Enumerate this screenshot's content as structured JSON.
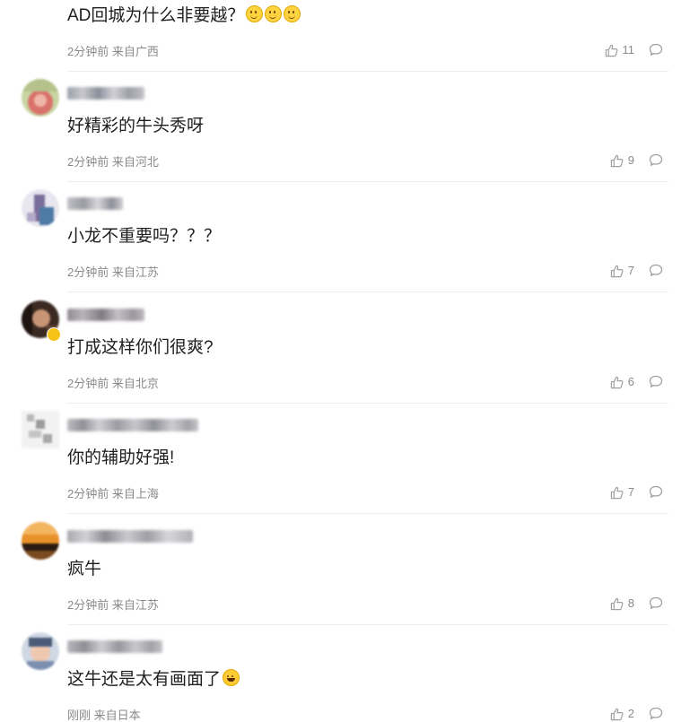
{
  "colors": {
    "meta_text": "#8a8a8a",
    "body_text": "#1f1f1f",
    "divider": "#ececec",
    "icon_stroke": "#a0a0a0"
  },
  "comments": [
    {
      "text": "AD回城为什么非要越？",
      "emojis": [
        "smile-emoji",
        "smile-emoji",
        "smile-emoji"
      ],
      "meta": "2分钟前 来自广西",
      "likes": "11"
    },
    {
      "text": "好精彩的牛头秀呀",
      "meta": "2分钟前 来自河北",
      "likes": "9"
    },
    {
      "text": "小龙不重要吗？？？",
      "meta": "2分钟前 来自江苏",
      "likes": "7"
    },
    {
      "text": "打成这样你们很爽?",
      "meta": "2分钟前 来自北京",
      "likes": "6"
    },
    {
      "text": "你的辅助好强!",
      "meta": "2分钟前 来自上海",
      "likes": "7"
    },
    {
      "text": "疯牛",
      "meta": "2分钟前 来自江苏",
      "likes": "8"
    },
    {
      "text": "这牛还是太有画面了",
      "emojis": [
        "laughing-tears-emoji"
      ],
      "meta": "刚刚 来自日本",
      "likes": "2"
    }
  ],
  "icons": {
    "like": "thumbs-up-icon",
    "reply": "comment-bubble-icon"
  }
}
